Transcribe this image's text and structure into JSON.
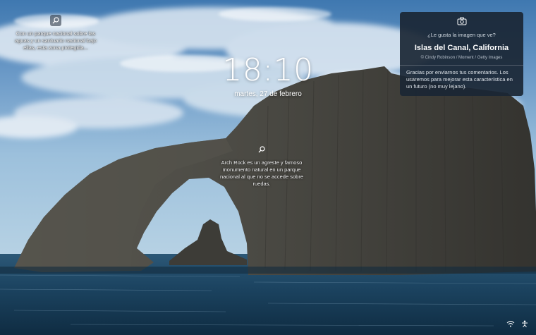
{
  "lock_screen": {
    "time": "18:10",
    "date": "martes, 27 de febrero"
  },
  "hotspots": [
    {
      "icon": "search-icon",
      "text": "Con un parque nacional sobre las aguas y un santuario nacional bajo ellas, esta zona protegida..."
    },
    {
      "icon": "search-icon",
      "text": "Arch Rock es un agreste y famoso monumento natural en un parque nacional al que no se accede sobre ruedas."
    }
  ],
  "image_info": {
    "icon": "camera-icon",
    "question": "¿Le gusta la imagen que ve?",
    "title": "Islas del Canal, California",
    "credit": "© Cindy Robinson / Moment / Getty Images",
    "feedback": "Gracias por enviarnos tus comentarios. Los usaremos para mejorar esta característica en un futuro (no muy lejano)."
  },
  "system_tray": {
    "icons": [
      "network-icon",
      "accessibility-icon"
    ]
  },
  "colors": {
    "sky_top": "#4f85b8",
    "sea": "#173a52",
    "rock": "#4a4a46",
    "card_bg": "#1a2634"
  }
}
